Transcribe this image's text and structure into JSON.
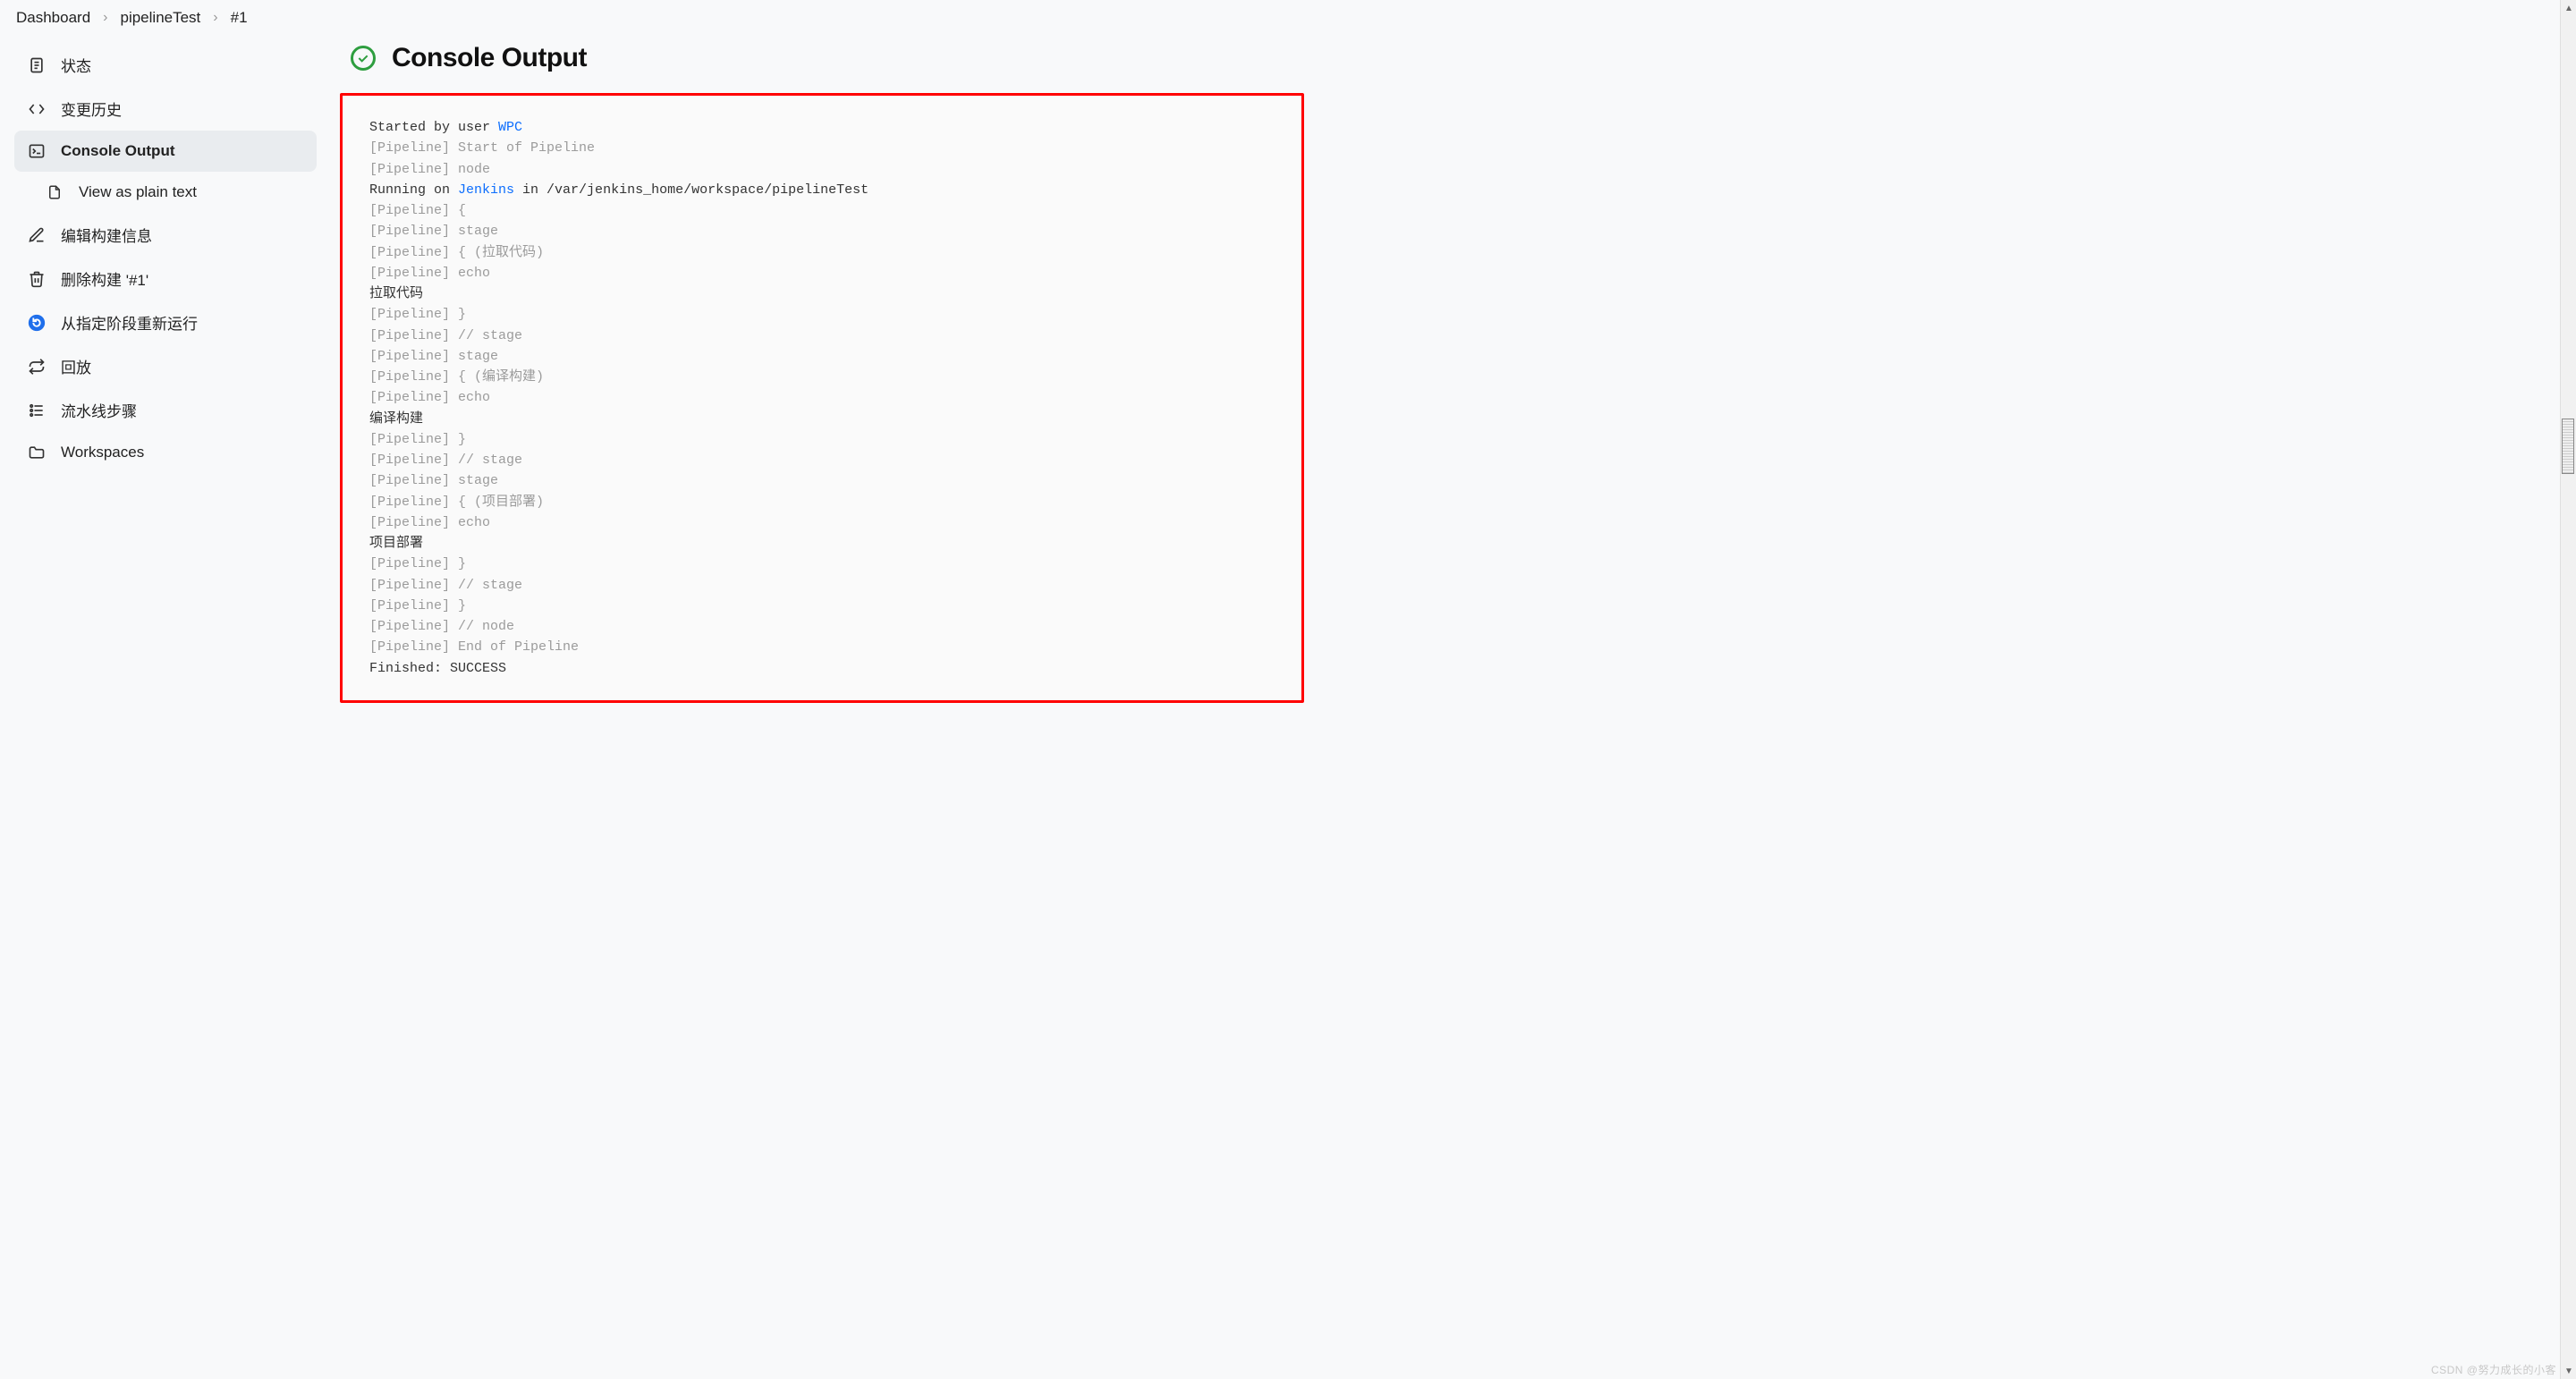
{
  "breadcrumb": {
    "items": [
      "Dashboard",
      "pipelineTest",
      "#1"
    ]
  },
  "sidebar": {
    "items": [
      {
        "icon": "page-icon",
        "label": "状态"
      },
      {
        "icon": "code-icon",
        "label": "变更历史"
      },
      {
        "icon": "terminal-icon",
        "label": "Console Output",
        "active": true
      },
      {
        "icon": "page-icon",
        "label": "View as plain text",
        "sub": true
      },
      {
        "icon": "edit-icon",
        "label": "编辑构建信息"
      },
      {
        "icon": "trash-icon",
        "label": "删除构建 '#1'"
      },
      {
        "icon": "restart-icon",
        "label": "从指定阶段重新运行"
      },
      {
        "icon": "replay-icon",
        "label": "回放"
      },
      {
        "icon": "steps-icon",
        "label": "流水线步骤"
      },
      {
        "icon": "folder-icon",
        "label": "Workspaces"
      }
    ]
  },
  "title": "Console Output",
  "console": {
    "started_prefix": "Started by user ",
    "started_user": "WPC",
    "running_prefix": "Running on ",
    "running_link": "Jenkins",
    "running_suffix": " in /var/jenkins_home/workspace/pipelineTest",
    "pipeline_tag": "[Pipeline]",
    "l_start": " Start of Pipeline",
    "l_node": " node",
    "l_open": " {",
    "l_stage": " stage",
    "l_open_paren": " { (",
    "l_close_paren": ")",
    "l_echo": " echo",
    "l_close": " }",
    "l_end_stage": " // stage",
    "l_end_node": " // node",
    "l_end_pipeline": " End of Pipeline",
    "stage1_name": "拉取代码",
    "stage1_echo": "拉取代码",
    "stage2_name": "编译构建",
    "stage2_echo": "编译构建",
    "stage3_name": "项目部署",
    "stage3_echo": "项目部署",
    "finished": "Finished: SUCCESS"
  },
  "watermark": "CSDN @努力成长的小客"
}
